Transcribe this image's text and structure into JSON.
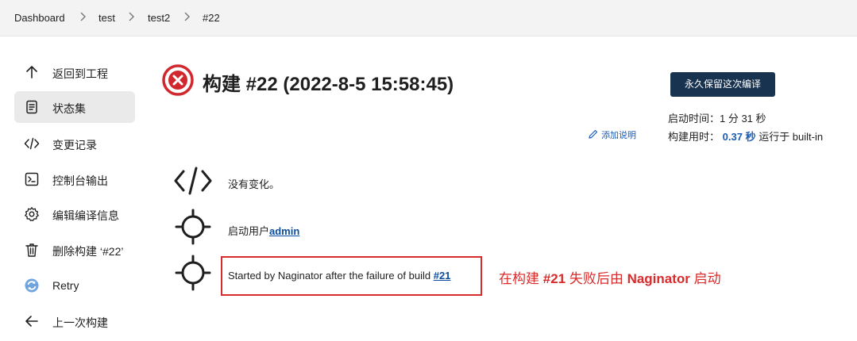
{
  "breadcrumb": {
    "items": [
      "Dashboard",
      "test",
      "test2",
      "#22"
    ],
    "separator": ">"
  },
  "sidebar": {
    "items": [
      {
        "label": "返回到工程",
        "icon": "arrow-up-icon"
      },
      {
        "label": "状态集",
        "icon": "document-icon"
      },
      {
        "label": "变更记录",
        "icon": "code-icon"
      },
      {
        "label": "控制台输出",
        "icon": "terminal-icon"
      },
      {
        "label": "编辑编译信息",
        "icon": "gear-icon"
      },
      {
        "label": "删除构建 ‘#22’",
        "icon": "trash-icon"
      },
      {
        "label": "Retry",
        "icon": "retry-icon"
      },
      {
        "label": "上一次构建",
        "icon": "arrow-left-icon"
      }
    ]
  },
  "build": {
    "title": "构建 #22 (2022-8-5 15:58:45)",
    "status_icon": "failed-icon",
    "status_color": "#d0282e",
    "keep_button": "永久保留这次编译",
    "add_description": "添加说明",
    "started_label": "启动时间：1 分 31 秒",
    "duration_label": "构建用时：",
    "duration_value": "0.37 秒",
    "ran_on": "运行于 built-in"
  },
  "details": {
    "no_changes": "没有变化。",
    "started_by_user_prefix": "启动用户",
    "started_by_user": "admin",
    "naginator_prefix": "Started by Naginator after the failure of build ",
    "naginator_link": "#21"
  },
  "annotation": {
    "part1": "在构建 ",
    "part2": "#21",
    "part3": " 失败后由 ",
    "part4": "Naginator",
    "part5": " 启动",
    "color": "#d82b2b"
  }
}
